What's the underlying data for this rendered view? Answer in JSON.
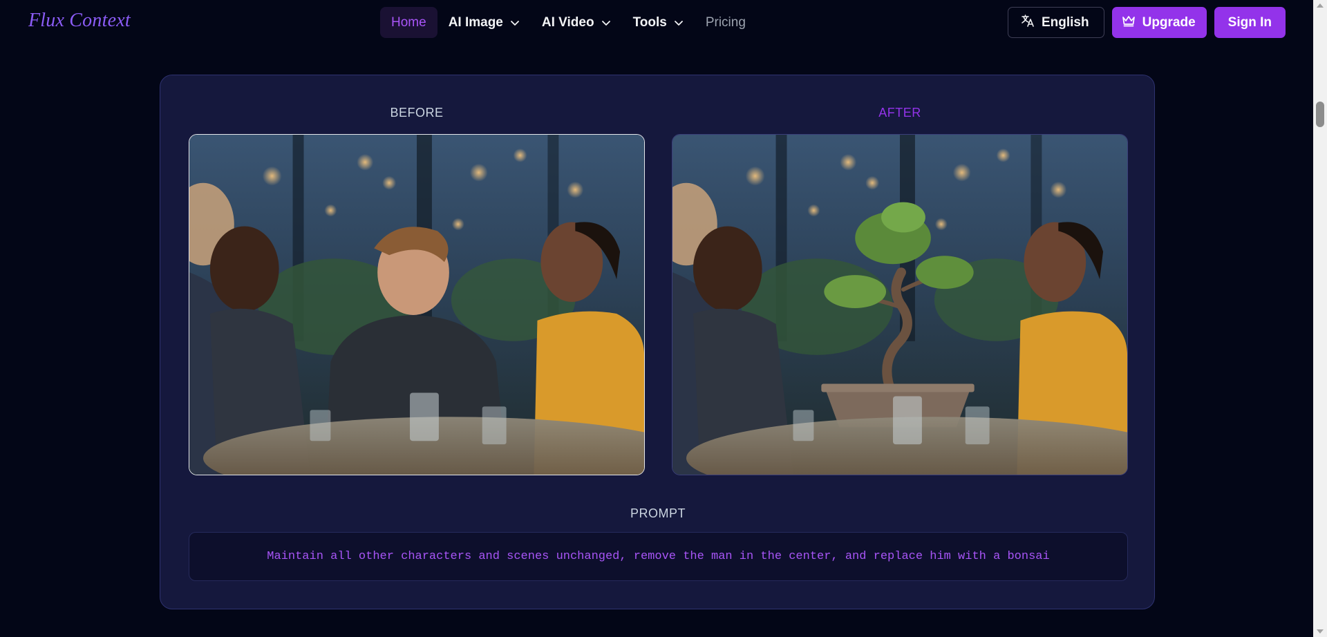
{
  "brand": {
    "logo_text": "Flux Context"
  },
  "nav": {
    "items": [
      {
        "label": "Home",
        "active": true,
        "has_dropdown": false
      },
      {
        "label": "AI Image",
        "active": false,
        "has_dropdown": true
      },
      {
        "label": "AI Video",
        "active": false,
        "has_dropdown": true
      },
      {
        "label": "Tools",
        "active": false,
        "has_dropdown": true
      },
      {
        "label": "Pricing",
        "active": false,
        "has_dropdown": false
      }
    ]
  },
  "actions": {
    "language_label": "English",
    "language_icon": "translate-icon",
    "upgrade_label": "Upgrade",
    "upgrade_icon": "crown-icon",
    "signin_label": "Sign In"
  },
  "comparison": {
    "before_label": "BEFORE",
    "after_label": "AFTER",
    "prompt_label": "PROMPT",
    "prompt_text": "Maintain all other characters and scenes unchanged, remove the man in the center, and replace him with a bonsai"
  },
  "colors": {
    "background": "#030617",
    "accent": "#9333ea",
    "card": "#15183d",
    "prompt_text": "#a855f7"
  }
}
